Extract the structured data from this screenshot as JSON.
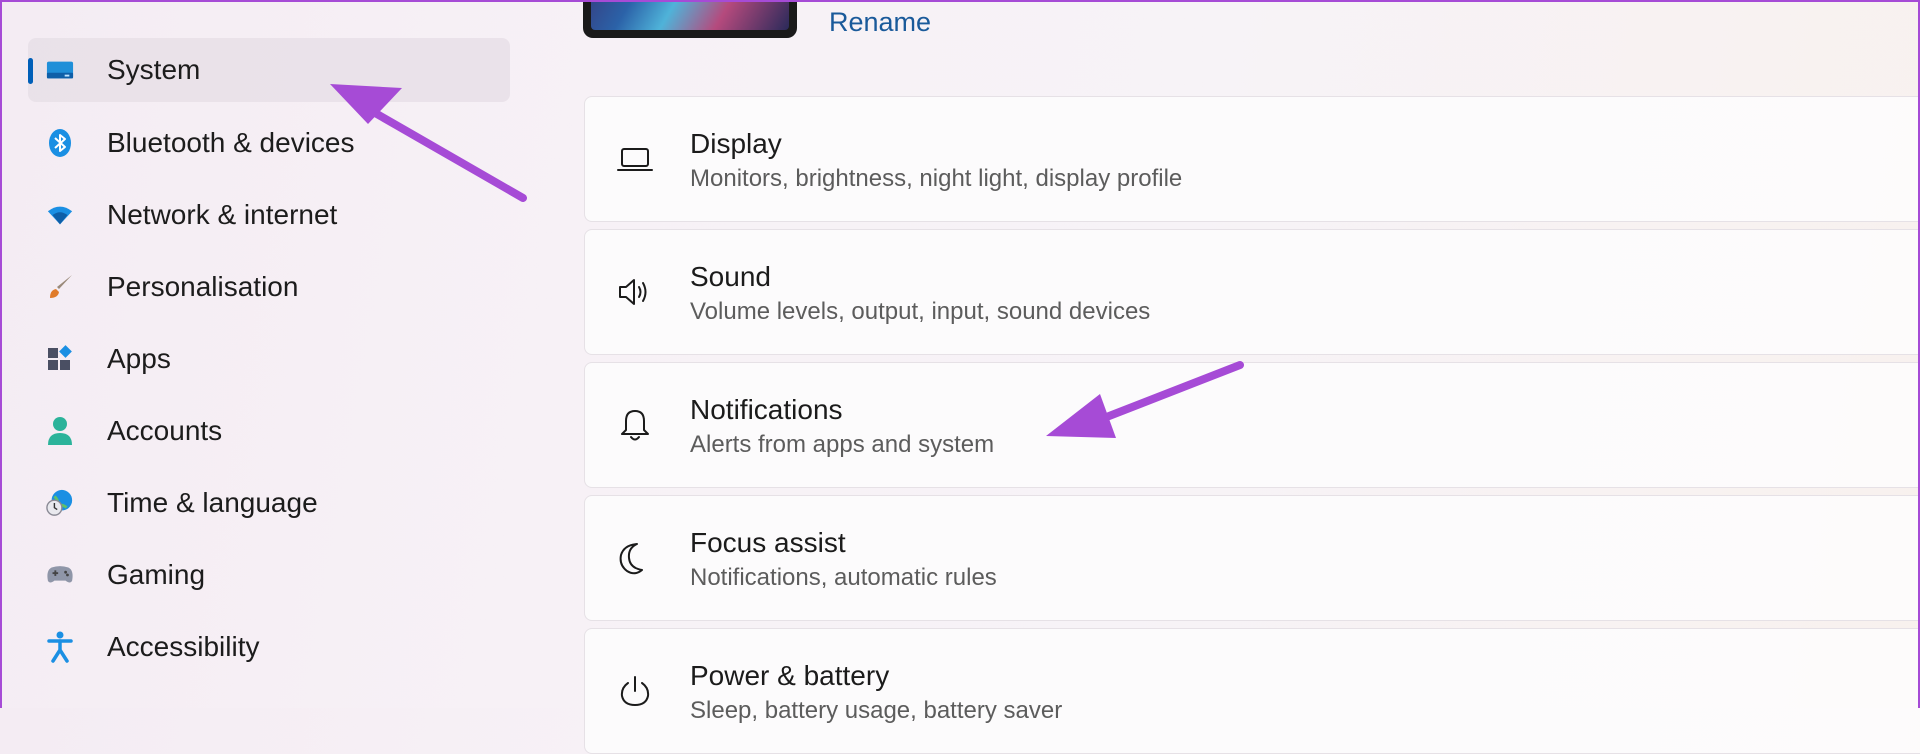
{
  "sidebar": {
    "items": [
      {
        "label": "System",
        "icon": "monitor-icon",
        "selected": true
      },
      {
        "label": "Bluetooth & devices",
        "icon": "bluetooth-icon"
      },
      {
        "label": "Network & internet",
        "icon": "wifi-icon"
      },
      {
        "label": "Personalisation",
        "icon": "paintbrush-icon"
      },
      {
        "label": "Apps",
        "icon": "apps-icon"
      },
      {
        "label": "Accounts",
        "icon": "person-icon"
      },
      {
        "label": "Time & language",
        "icon": "globe-clock-icon"
      },
      {
        "label": "Gaming",
        "icon": "gamepad-icon"
      },
      {
        "label": "Accessibility",
        "icon": "accessibility-icon"
      }
    ]
  },
  "device": {
    "rename_label": "Rename"
  },
  "settings": [
    {
      "title": "Display",
      "subtitle": "Monitors, brightness, night light, display profile",
      "icon": "laptop-icon"
    },
    {
      "title": "Sound",
      "subtitle": "Volume levels, output, input, sound devices",
      "icon": "speaker-icon"
    },
    {
      "title": "Notifications",
      "subtitle": "Alerts from apps and system",
      "icon": "bell-icon"
    },
    {
      "title": "Focus assist",
      "subtitle": "Notifications, automatic rules",
      "icon": "moon-icon"
    },
    {
      "title": "Power & battery",
      "subtitle": "Sleep, battery usage, battery saver",
      "icon": "power-icon"
    }
  ],
  "colors": {
    "accent": "#005fb8",
    "annotation_arrow": "#a64bd6",
    "frame": "#a64bd6"
  }
}
